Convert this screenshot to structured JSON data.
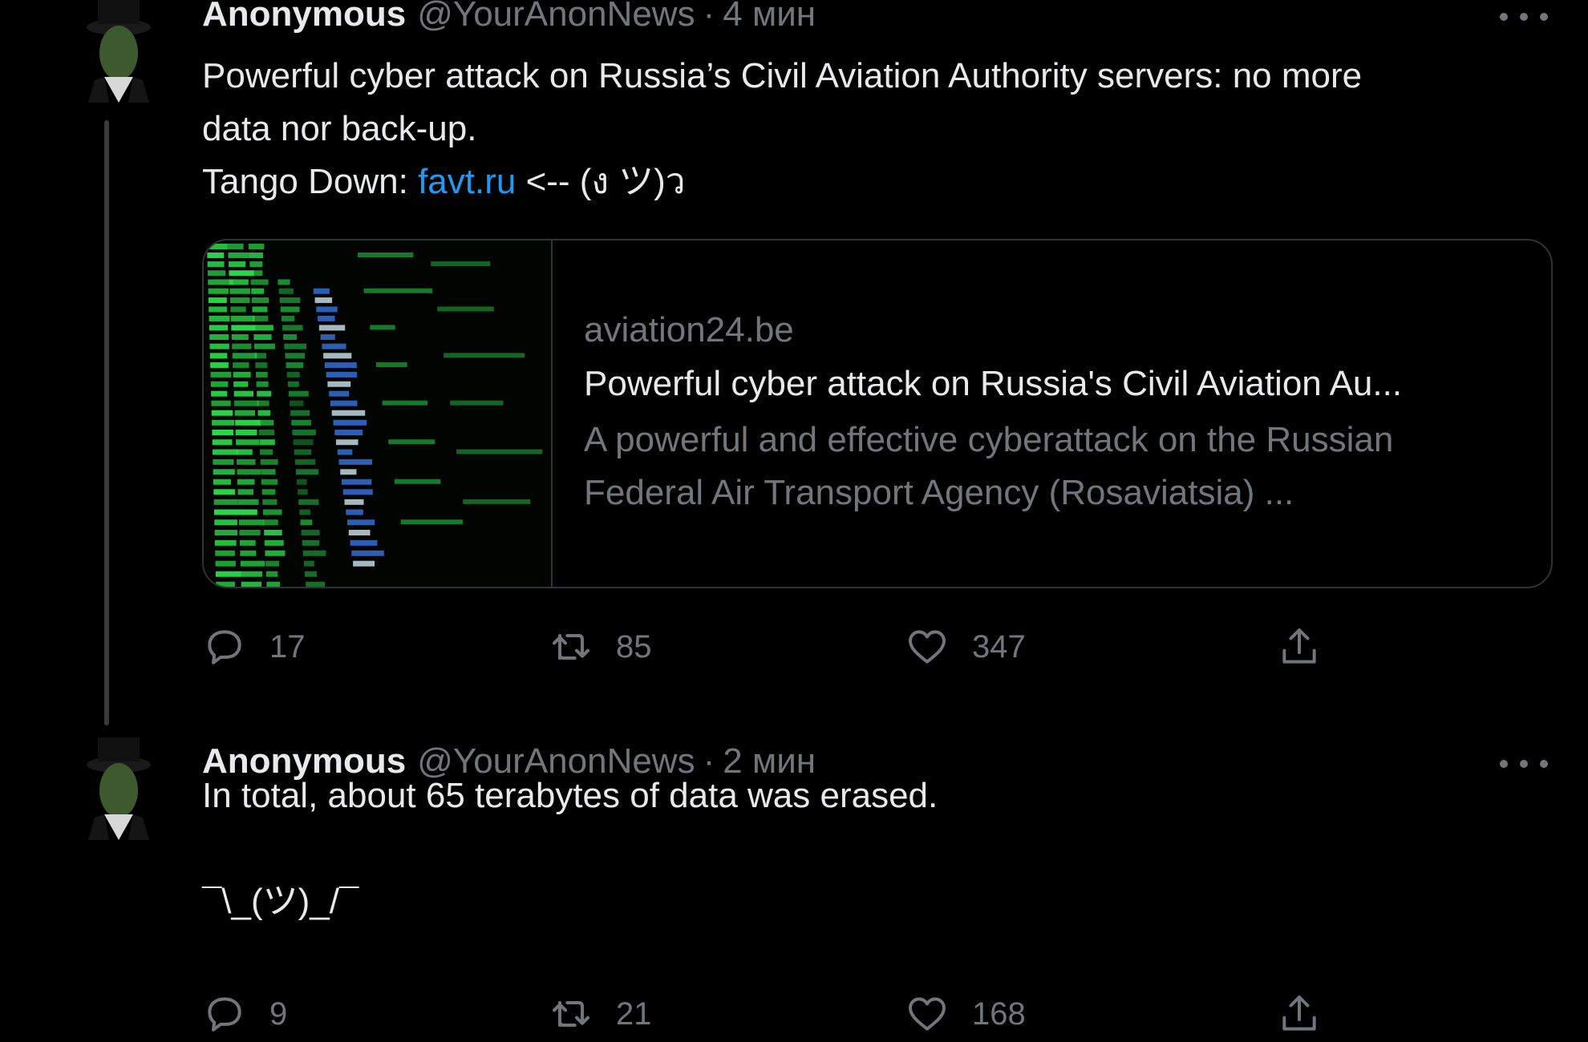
{
  "tweets": [
    {
      "name": "Anonymous",
      "handle": "@YourAnonNews",
      "separator": "·",
      "time": "4 мин",
      "text": {
        "line1": "Powerful cyber attack on Russia’s Civil Aviation Authority servers: no more",
        "line2": "data nor back-up.",
        "line3_prefix": "Tango Down: ",
        "line3_link": "favt.ru",
        "line3_suffix": " <-- (ง ツ)ว"
      },
      "card": {
        "domain": "aviation24.be",
        "title": "Powerful cyber attack on Russia's Civil Aviation Au...",
        "description_line1": "A powerful and effective cyberattack on the Russian",
        "description_line2": "Federal Air Transport Agency (Rosaviatsia) ..."
      },
      "actions": {
        "replies": "17",
        "retweets": "85",
        "likes": "347"
      }
    },
    {
      "name": "Anonymous",
      "handle": "@YourAnonNews",
      "separator": "·",
      "time": "2 мин",
      "text": {
        "line1": "In total, about 65 terabytes of data was erased.",
        "line3": "¯\\_(ツ)_/¯"
      },
      "actions": {
        "replies": "9",
        "retweets": "21",
        "likes": "168"
      }
    }
  ],
  "colors": {
    "background": "#000000",
    "text": "#e7e9ea",
    "secondary": "#71767b",
    "link": "#1d9bf0",
    "border": "#2f3336"
  },
  "icons": [
    "avatar-mask-icon",
    "more-icon",
    "reply-icon",
    "retweet-icon",
    "like-icon",
    "share-icon"
  ]
}
